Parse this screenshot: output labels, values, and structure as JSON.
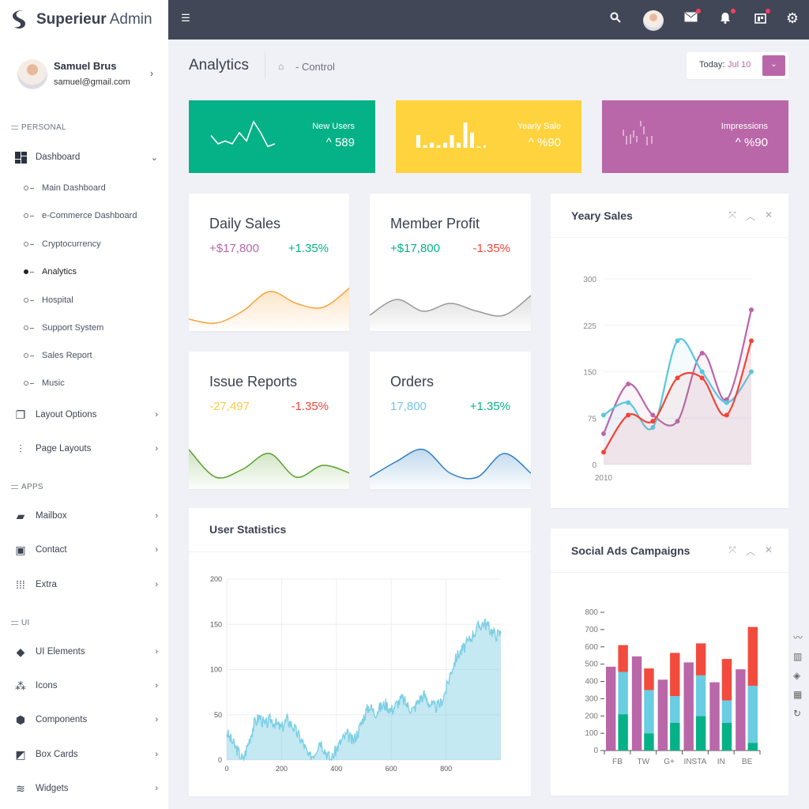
{
  "brand": {
    "name_bold": "Superieur",
    "name_light": "Admin"
  },
  "profile": {
    "name": "Samuel Brus",
    "email": "samuel@gmail.com"
  },
  "sidebar": {
    "sections": [
      "PERSONAL",
      "APPS",
      "UI"
    ],
    "dashboard": {
      "label": "Dashboard",
      "sub": [
        "Main Dashboard",
        "e-Commerce Dashboard",
        "Cryptocurrency",
        "Analytics",
        "Hospital",
        "Support System",
        "Sales Report",
        "Music"
      ],
      "active": "Analytics"
    },
    "items": [
      {
        "label": "Layout Options"
      },
      {
        "label": "Page Layouts"
      },
      {
        "label": "Mailbox"
      },
      {
        "label": "Contact"
      },
      {
        "label": "Extra"
      },
      {
        "label": "UI Elements"
      },
      {
        "label": "Icons"
      },
      {
        "label": "Components"
      },
      {
        "label": "Box Cards"
      },
      {
        "label": "Widgets"
      }
    ]
  },
  "header": {
    "notification_color": "#fa3e5f"
  },
  "page": {
    "title": "Analytics",
    "breadcrumb": "- Control",
    "today_label": "Today:",
    "today_value": "Jul 10"
  },
  "stats": [
    {
      "label": "New Users",
      "value": "589",
      "color": "#05b187",
      "spark": [
        5,
        2,
        3,
        2,
        6,
        3,
        10,
        6,
        1,
        2
      ]
    },
    {
      "label": "Yearly Sale",
      "value": "%90",
      "color": "#ffd33d",
      "spark": [
        5,
        1,
        2,
        1,
        2,
        5,
        2,
        10,
        6,
        0,
        1
      ]
    },
    {
      "label": "Impressions",
      "value": "%90",
      "color": "#b967a9"
    }
  ],
  "mini_cards": [
    {
      "title": "Daily Sales",
      "v1": "+$17,800",
      "v1_color": "#b967a9",
      "v2": "+1.35%",
      "v2_color": "#05b187",
      "line": "#f7a33a",
      "spark": [
        2,
        1,
        4,
        9,
        6,
        5,
        10
      ]
    },
    {
      "title": "Member Profit",
      "v1": "+$17,800",
      "v1_color": "#05b187",
      "v2": "-1.35%",
      "v2_color": "#f44336",
      "line": "#999999",
      "spark": [
        3,
        7,
        4,
        6,
        4,
        3,
        8
      ]
    },
    {
      "title": "Issue Reports",
      "v1": "-27,497",
      "v1_color": "#ffc94a",
      "v2": "-1.35%",
      "v2_color": "#f44336",
      "line": "#5aa02c",
      "spark": [
        9,
        2,
        4,
        8,
        2,
        5,
        3
      ]
    },
    {
      "title": "Orders",
      "v1": "17,800",
      "v1_color": "#74c6e0",
      "v2": "+1.35%",
      "v2_color": "#05b187",
      "line": "#2f7fc4",
      "spark": [
        2,
        6,
        9,
        3,
        2,
        8,
        3
      ]
    }
  ],
  "yearly_sales": {
    "title": "Yeary Sales"
  },
  "user_stats": {
    "title": "User Statistics"
  },
  "social_ads": {
    "title": "Social Ads Campaigns"
  },
  "chart_data": [
    {
      "type": "line",
      "title": "Yeary Sales",
      "x": [
        2010,
        2011,
        2012,
        2013,
        2014,
        2015,
        2016
      ],
      "x_tick_labels": [
        "2010"
      ],
      "ylim": [
        0,
        300
      ],
      "yticks": [
        0,
        75,
        150,
        225,
        300
      ],
      "grid": true,
      "series": [
        {
          "color": "#b967a9",
          "values": [
            50,
            130,
            80,
            70,
            180,
            105,
            250
          ]
        },
        {
          "color": "#5bc6e0",
          "values": [
            80,
            100,
            60,
            200,
            150,
            100,
            150
          ]
        },
        {
          "color": "#f44336",
          "values": [
            20,
            80,
            70,
            140,
            140,
            80,
            200
          ]
        }
      ]
    },
    {
      "type": "area",
      "title": "User Statistics",
      "xlim": [
        0,
        1000
      ],
      "xticks": [
        0,
        200,
        400,
        600,
        800
      ],
      "ylim": [
        0,
        200
      ],
      "yticks": [
        0,
        50,
        100,
        150,
        200
      ],
      "grid": true,
      "color": "#7ccfe4",
      "x": [
        0,
        20,
        40,
        60,
        80,
        100,
        120,
        140,
        160,
        180,
        200,
        220,
        240,
        260,
        280,
        300,
        320,
        340,
        360,
        380,
        400,
        420,
        440,
        460,
        480,
        500,
        520,
        540,
        560,
        580,
        600,
        620,
        640,
        660,
        680,
        700,
        720,
        740,
        760,
        780,
        800,
        820,
        840,
        860,
        880,
        900,
        920,
        940,
        960,
        980,
        1000
      ],
      "y": [
        30,
        20,
        10,
        0,
        20,
        40,
        48,
        38,
        45,
        40,
        35,
        45,
        38,
        28,
        18,
        2,
        8,
        22,
        10,
        0,
        12,
        22,
        28,
        20,
        32,
        48,
        60,
        52,
        58,
        62,
        55,
        62,
        68,
        60,
        55,
        66,
        72,
        62,
        58,
        62,
        78,
        100,
        115,
        122,
        130,
        140,
        148,
        152,
        145,
        138,
        140
      ]
    },
    {
      "type": "bar",
      "title": "Social Ads Campaigns",
      "categories": [
        "FB",
        "TW",
        "G+",
        "INSTA",
        "IN",
        "BE"
      ],
      "ylim": [
        0,
        800
      ],
      "yticks": [
        0,
        100,
        200,
        300,
        400,
        500,
        600,
        700,
        800
      ],
      "series": [
        {
          "color": "#b967a9",
          "stack": "a",
          "values": [
            485,
            545,
            410,
            510,
            395,
            470
          ]
        },
        {
          "color": "#05b187",
          "stack": "b",
          "values": [
            210,
            100,
            160,
            200,
            160,
            45
          ]
        },
        {
          "color": "#6acde2",
          "stack": "b",
          "values": [
            245,
            250,
            155,
            235,
            130,
            330
          ]
        },
        {
          "color": "#f24b3d",
          "stack": "b",
          "values": [
            155,
            125,
            250,
            185,
            240,
            340
          ]
        }
      ]
    }
  ]
}
